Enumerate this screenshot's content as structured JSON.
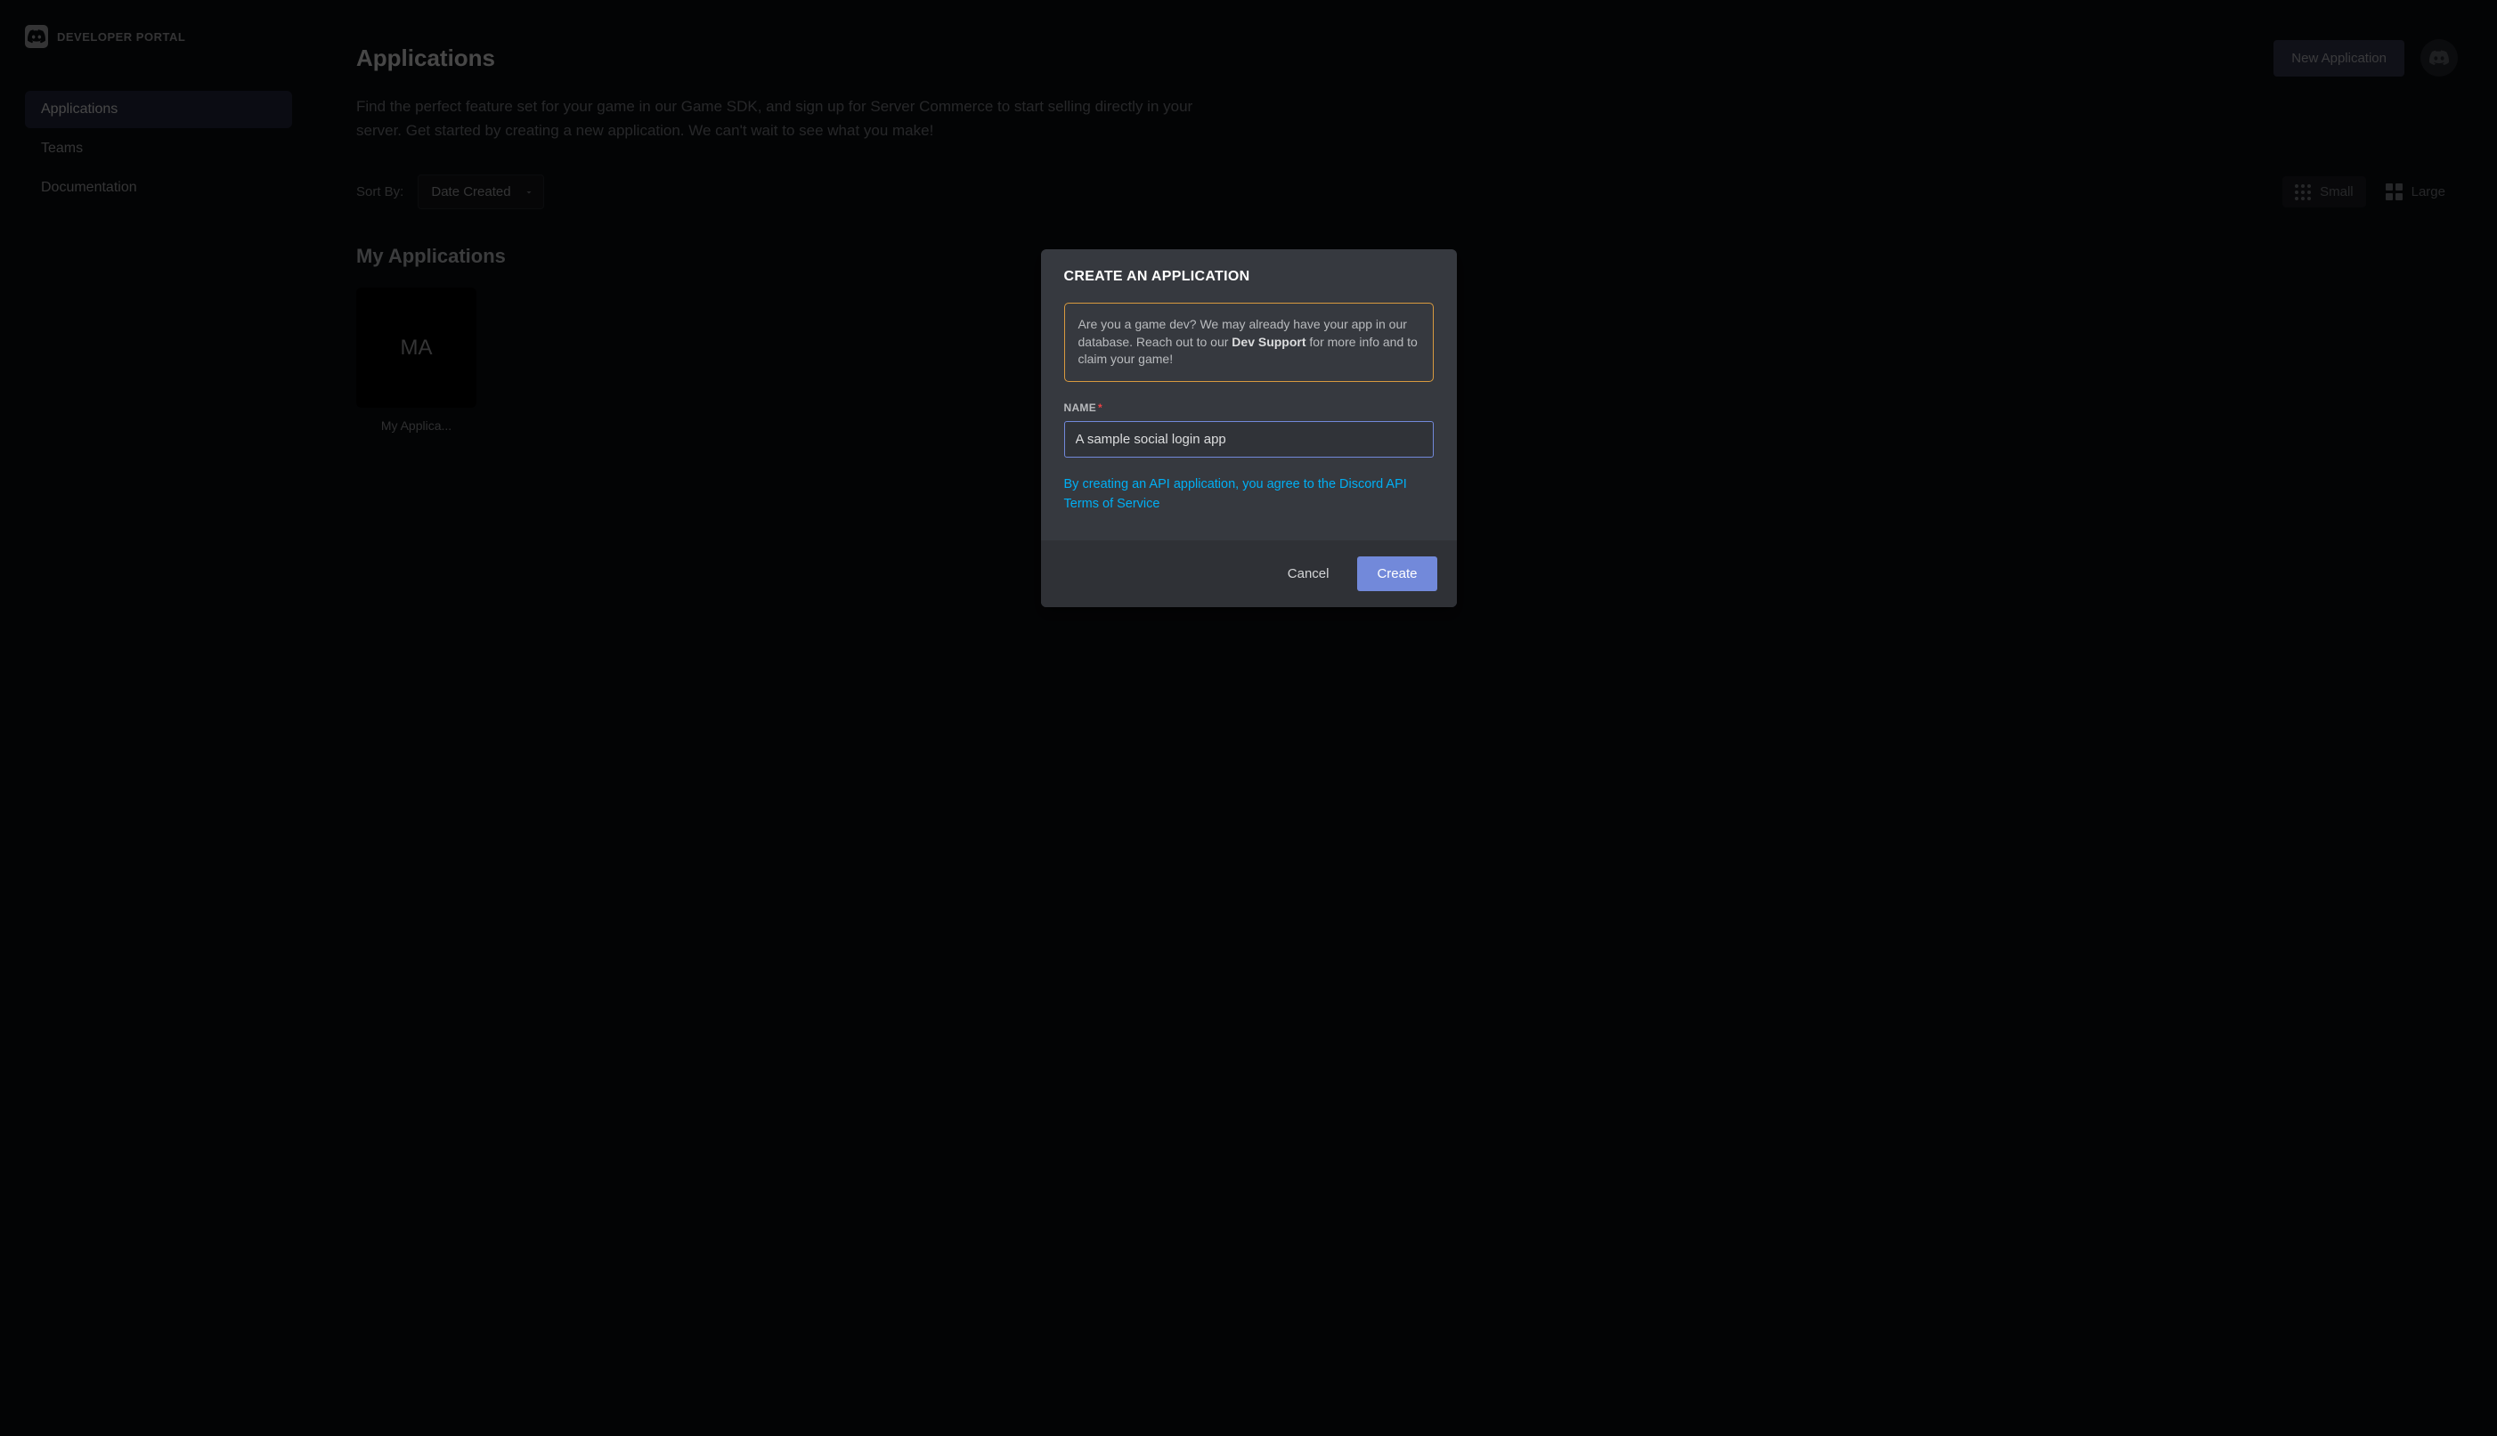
{
  "brand": {
    "label": "DEVELOPER PORTAL"
  },
  "sidebar": {
    "items": [
      {
        "label": "Applications",
        "active": true
      },
      {
        "label": "Teams",
        "active": false
      },
      {
        "label": "Documentation",
        "active": false
      }
    ]
  },
  "header": {
    "title": "Applications",
    "new_app_button": "New Application",
    "description": "Find the perfect feature set for your game in our Game SDK, and sign up for Server Commerce to start selling directly in your server. Get started by creating a new application. We can't wait to see what you make!"
  },
  "toolbar": {
    "sort_label": "Sort By:",
    "sort_value": "Date Created",
    "view_small": "Small",
    "view_large": "Large"
  },
  "my_apps": {
    "section_title": "My Applications",
    "cards": [
      {
        "initials": "MA",
        "name": "My Applica..."
      }
    ]
  },
  "modal": {
    "title": "CREATE AN APPLICATION",
    "info_prefix": "Are you a game dev? We may already have your app in our database. Reach out to our ",
    "info_strong": "Dev Support",
    "info_suffix": " for more info and to claim your game!",
    "name_label": "NAME",
    "name_value": "A sample social login app",
    "tos_text": "By creating an API application, you agree to the Discord API Terms of Service",
    "cancel_label": "Cancel",
    "create_label": "Create"
  }
}
